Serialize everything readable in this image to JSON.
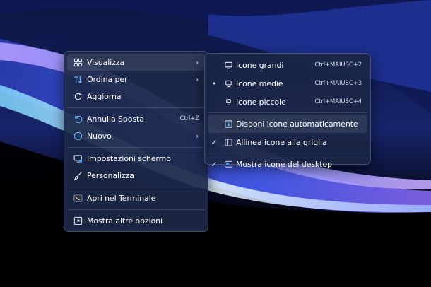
{
  "main_menu": {
    "items": [
      {
        "label": "Visualizza",
        "icon": "grid-icon",
        "has_submenu": true
      },
      {
        "label": "Ordina per",
        "icon": "sort-icon",
        "has_submenu": true
      },
      {
        "label": "Aggiorna",
        "icon": "refresh-icon"
      },
      {
        "label": "Annulla Sposta",
        "icon": "undo-icon",
        "shortcut": "Ctrl+Z"
      },
      {
        "label": "Nuovo",
        "icon": "new-plus-icon",
        "has_submenu": true
      },
      {
        "label": "Impostazioni schermo",
        "icon": "display-settings-icon"
      },
      {
        "label": "Personalizza",
        "icon": "brush-icon"
      },
      {
        "label": "Apri nel Terminale",
        "icon": "terminal-icon"
      },
      {
        "label": "Mostra altre opzioni",
        "icon": "more-options-icon"
      }
    ],
    "arrow_glyph": "›"
  },
  "sub_menu": {
    "items": [
      {
        "label": "Icone grandi",
        "icon": "monitor-large-icon",
        "shortcut": "Ctrl+MAIUSC+2",
        "marked": false
      },
      {
        "label": "Icone medie",
        "icon": "monitor-medium-icon",
        "shortcut": "Ctrl+MAIUSC+3",
        "marked": true
      },
      {
        "label": "Icone piccole",
        "icon": "monitor-small-icon",
        "shortcut": "Ctrl+MAIUSC+4",
        "marked": false
      },
      {
        "label": "Disponi icone automaticamente",
        "icon": "auto-arrange-icon",
        "checked": false
      },
      {
        "label": "Allinea icone alla griglia",
        "icon": "align-grid-icon",
        "checked": true
      },
      {
        "label": "Mostra icone del desktop",
        "icon": "show-desktop-icon",
        "checked": true
      }
    ],
    "bullet_glyph": "•",
    "check_glyph": "✓"
  },
  "colors": {
    "menu_bg": "#1c2848",
    "accent_blue": "#4aa8ff",
    "wallpaper_glow": "#8fa7ff"
  }
}
